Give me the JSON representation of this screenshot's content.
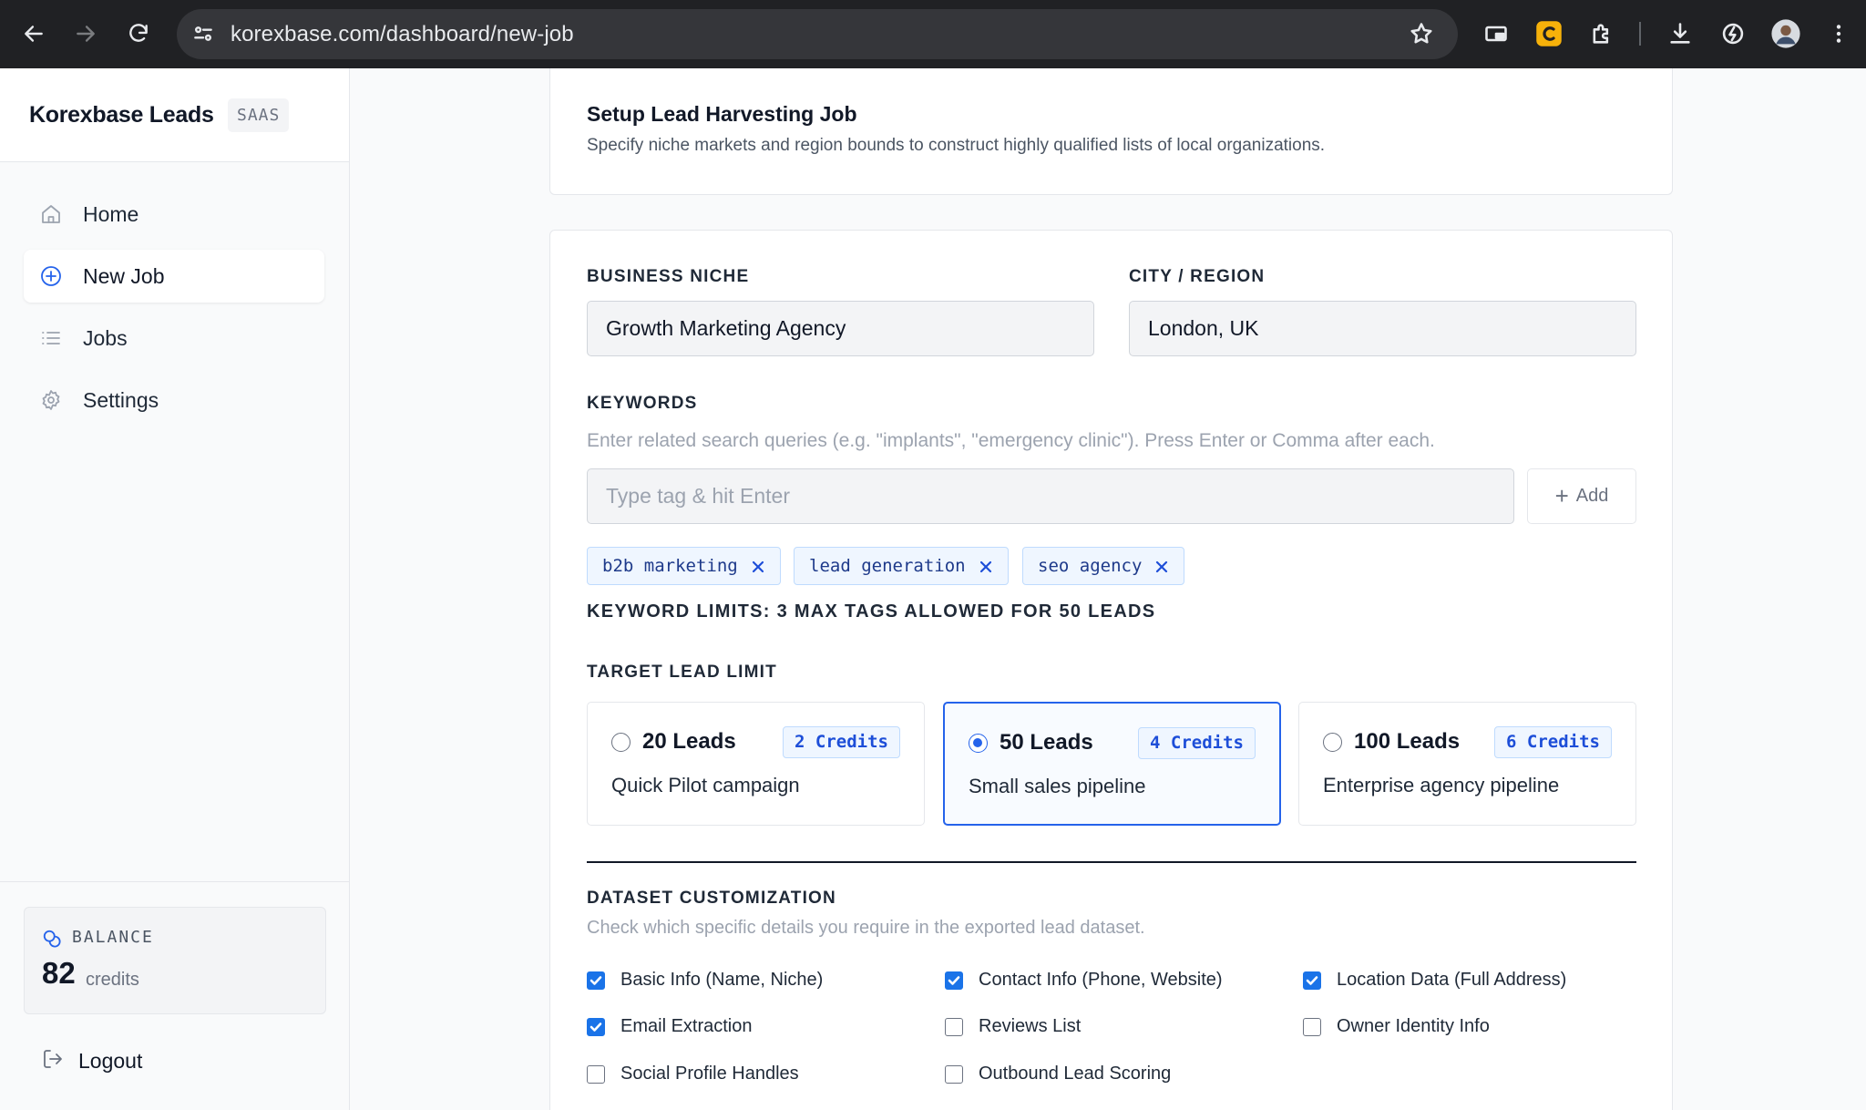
{
  "browser": {
    "url": "korexbase.com/dashboard/new-job"
  },
  "sidebar": {
    "brand": "Korexbase Leads",
    "badge": "SAAS",
    "items": [
      {
        "label": "Home",
        "icon": "home-icon",
        "active": false
      },
      {
        "label": "New Job",
        "icon": "plus-circle-icon",
        "active": true
      },
      {
        "label": "Jobs",
        "icon": "list-icon",
        "active": false
      },
      {
        "label": "Settings",
        "icon": "gear-icon",
        "active": false
      }
    ],
    "balance": {
      "label": "BALANCE",
      "value": "82",
      "unit": "credits"
    },
    "logout": "Logout"
  },
  "header": {
    "title": "Setup Lead Harvesting Job",
    "subtitle": "Specify niche markets and region bounds to construct highly qualified lists of local organizations."
  },
  "form": {
    "niche": {
      "label": "BUSINESS NICHE",
      "value": "Growth Marketing Agency"
    },
    "city": {
      "label": "CITY / REGION",
      "value": "London, UK"
    },
    "keywords": {
      "label": "KEYWORDS",
      "hint": "Enter related search queries (e.g. \"implants\", \"emergency clinic\"). Press Enter or Comma after each.",
      "placeholder": "Type tag & hit Enter",
      "add_label": "Add",
      "tags": [
        "b2b marketing",
        "lead generation",
        "seo agency"
      ],
      "limit_note": "KEYWORD LIMITS: 3 MAX TAGS ALLOWED FOR 50 LEADS"
    },
    "lead_limit": {
      "label": "TARGET LEAD LIMIT",
      "options": [
        {
          "title": "20 Leads",
          "credits": "2 Credits",
          "desc": "Quick Pilot campaign",
          "selected": false
        },
        {
          "title": "50 Leads",
          "credits": "4 Credits",
          "desc": "Small sales pipeline",
          "selected": true
        },
        {
          "title": "100 Leads",
          "credits": "6 Credits",
          "desc": "Enterprise agency pipeline",
          "selected": false
        }
      ]
    },
    "dataset": {
      "label": "DATASET CUSTOMIZATION",
      "hint": "Check which specific details you require in the exported lead dataset.",
      "options": [
        {
          "label": "Basic Info (Name, Niche)",
          "checked": true
        },
        {
          "label": "Contact Info (Phone, Website)",
          "checked": true
        },
        {
          "label": "Location Data (Full Address)",
          "checked": true
        },
        {
          "label": "Email Extraction",
          "checked": true
        },
        {
          "label": "Reviews List",
          "checked": false
        },
        {
          "label": "Owner Identity Info",
          "checked": false
        },
        {
          "label": "Social Profile Handles",
          "checked": false
        },
        {
          "label": "Outbound Lead Scoring",
          "checked": false
        }
      ]
    }
  },
  "colors": {
    "accent": "#2563eb",
    "checkbox": "#1a73e8",
    "tag_bg": "#eff6ff"
  }
}
